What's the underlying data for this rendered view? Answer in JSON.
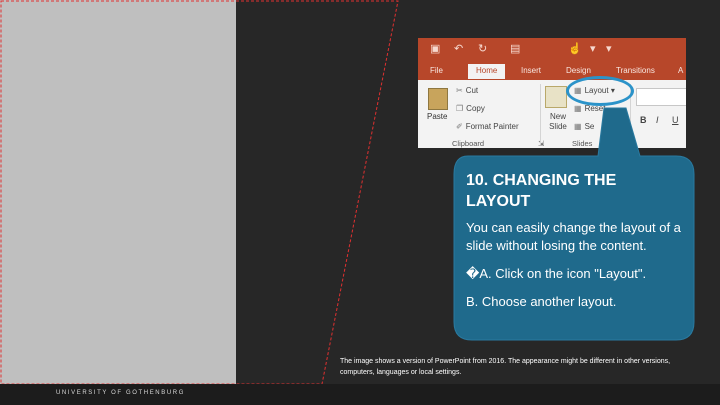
{
  "ribbon": {
    "tabs": [
      "File",
      "Home",
      "Insert",
      "Design",
      "Transitions",
      "A"
    ],
    "clipboard": {
      "paste": "Paste",
      "cut": "Cut",
      "copy": "Copy",
      "format_painter": "Format Painter",
      "group_label": "Clipboard"
    },
    "slides": {
      "new_slide": "New Slide",
      "layout": "Layout",
      "reset": "Reset",
      "section": "Se",
      "group_label": "Slides"
    },
    "font_buttons": [
      "B",
      "I",
      "U"
    ]
  },
  "callout": {
    "title": "10. CHANGING THE LAYOUT",
    "body": "You can easily change the layout of a slide without losing the content.",
    "step_a": "�A. Click on the icon \"Layout\".",
    "step_b": "B. Choose another layout."
  },
  "caption": "The image shows a version of PowerPoint from 2016. The appearance might be different in other versions, computers, languages or local settings.",
  "footer": {
    "university": "UNIVERSITY OF GOTHENBURG"
  },
  "colors": {
    "background": "#272727",
    "panel": "#bfbfbf",
    "ribbon_accent": "#b7472a",
    "callout_fill": "#1f6a8c",
    "highlight": "#2b93c9"
  }
}
